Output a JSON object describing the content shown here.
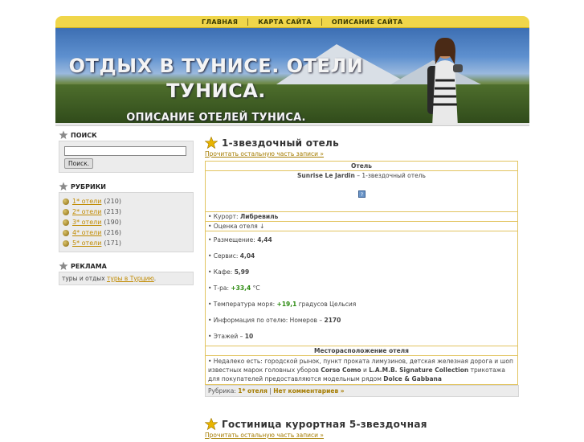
{
  "nav": {
    "items": [
      "ГЛАВНАЯ",
      "КАРТА САЙТА",
      "ОПИСАНИЕ САЙТА"
    ]
  },
  "header": {
    "title": "ОТДЫХ В ТУНИСЕ. ОТЕЛИ ТУНИСА.",
    "subtitle": "ОПИСАНИЕ ОТЕЛЕЙ ТУНИСА."
  },
  "sidebar": {
    "search": {
      "title": "ПОИСК",
      "button": "Поиск."
    },
    "rubrics": {
      "title": "РУБРИКИ",
      "items": [
        {
          "label": "1* отели",
          "count": "(210)"
        },
        {
          "label": "2* отели",
          "count": "(213)"
        },
        {
          "label": "3* отели",
          "count": "(190)"
        },
        {
          "label": "4* отели",
          "count": "(216)"
        },
        {
          "label": "5* отели",
          "count": "(171)"
        }
      ]
    },
    "ads": {
      "title": "РЕКЛАМА",
      "text": "туры и отдых",
      "link": "туры в Турцию",
      "end": "."
    }
  },
  "post1": {
    "title": "1-звездочный отель",
    "readmore": "Прочитать остальную часть записи »",
    "table_header": "Отель",
    "hotel_name": "Sunrise Le Jardin",
    "hotel_desc": "– 1-звездочный отель",
    "resort_label": "• Курорт:",
    "resort_value": "Либревиль",
    "rating_label": "• Оценка отеля ↓",
    "accommodation_label": "• Размещение:",
    "accommodation_value": "4,44",
    "service_label": "• Сервис:",
    "service_value": "4,04",
    "cafe_label": "• Кафе:",
    "cafe_value": "5,99",
    "temp_label": "• Т-ра:",
    "temp_value": "+33,4",
    "temp_unit": "°С",
    "sea_label": "• Температура моря:",
    "sea_value": "+19,1",
    "sea_unit": "градусов Цельсия",
    "info_label": "• Информация по отелю: Номеров –",
    "info_value": "2170",
    "floors_label": "• Этажей –",
    "floors_value": "10",
    "location_header": "Месторасположение отеля",
    "location_text_1": "• Недалеко есть: городской рынок, пункт проката лимузинов, детская железная дорога и шоп известных марок головных уборов",
    "location_bold_1": "Corso Como",
    "location_text_2": "и",
    "location_bold_2": "L.A.M.B. Signature Collection",
    "location_text_3": "трикотажа для покупателей предоставляются модельным рядом",
    "location_bold_3": "Dolce & Gabbana",
    "meta_label": "Рубрика:",
    "meta_category": "1* отеля",
    "meta_sep": "|",
    "meta_comments": "Нет комментариев »"
  },
  "post2": {
    "title": "Гостиница курортная 5-звездочная",
    "readmore": "Прочитать остальную часть записи »"
  }
}
